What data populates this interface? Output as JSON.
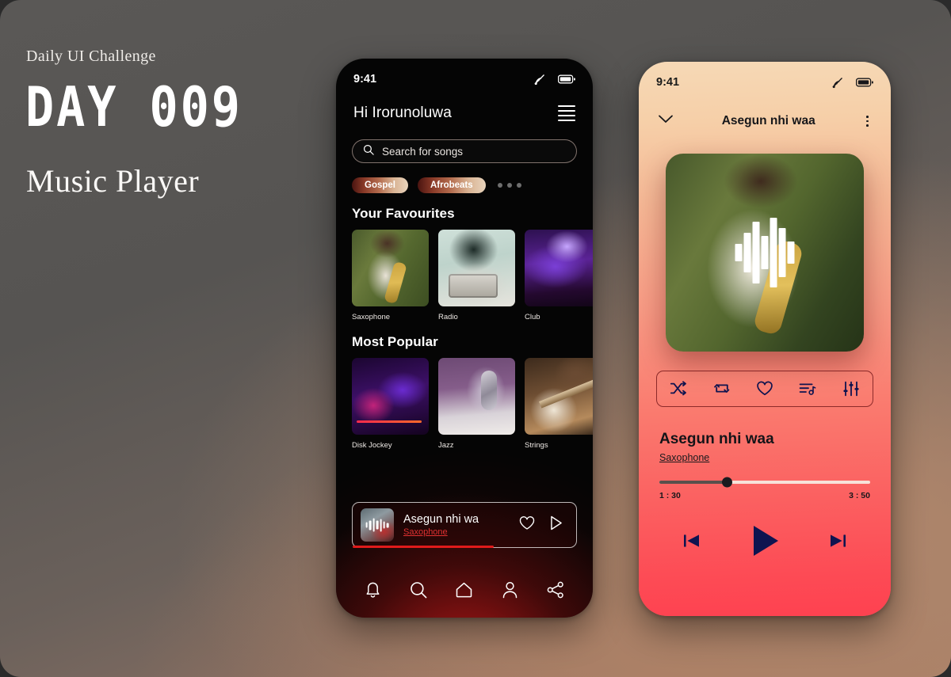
{
  "poster": {
    "challenge_label": "Daily UI Challenge",
    "day_number": "DAY 009",
    "project_title": "Music Player"
  },
  "colors": {
    "accent_red": "#e01b1b",
    "player_gradient_top": "#f6d9b6",
    "player_gradient_bottom": "#fe4150",
    "control_navy": "#0f1450",
    "chip_gradient_start": "#4a1410",
    "chip_gradient_end": "#e8d4bd"
  },
  "home_screen": {
    "status_bar": {
      "time": "9:41",
      "signal_icon": "wifi-signal-icon",
      "battery_icon": "battery-icon"
    },
    "greeting": "Hi Irorunoluwa",
    "menu_icon": "hamburger-menu-icon",
    "search": {
      "placeholder": "Search for songs",
      "icon": "search-icon"
    },
    "chips": [
      {
        "label": "Gospel"
      },
      {
        "label": "Afrobeats"
      }
    ],
    "chip_overflow_icon": "more-dots-icon",
    "sections": [
      {
        "title": "Your Favourites",
        "cards": [
          {
            "label": "Saxophone",
            "art": "art-sax"
          },
          {
            "label": "Radio",
            "art": "art-radio"
          },
          {
            "label": "Club",
            "art": "art-club"
          }
        ]
      },
      {
        "title": "Most Popular",
        "cards": [
          {
            "label": "Disk Jockey",
            "art": "art-dj"
          },
          {
            "label": "Jazz",
            "art": "art-jazz"
          },
          {
            "label": "Strings",
            "art": "art-strings"
          }
        ]
      }
    ],
    "mini_player": {
      "title": "Asegun nhi wa",
      "artist": "Saxophone",
      "like_icon": "heart-icon",
      "play_icon": "play-icon",
      "progress_percent": 63
    },
    "bottom_nav": [
      {
        "name": "notifications",
        "icon": "bell-icon"
      },
      {
        "name": "search",
        "icon": "search-icon"
      },
      {
        "name": "home",
        "icon": "home-icon"
      },
      {
        "name": "profile",
        "icon": "person-icon"
      },
      {
        "name": "share",
        "icon": "share-icon"
      }
    ]
  },
  "player_screen": {
    "status_bar": {
      "time": "9:41",
      "signal_icon": "wifi-signal-icon",
      "battery_icon": "battery-icon"
    },
    "topbar": {
      "collapse_icon": "chevron-down-icon",
      "title": "Asegun nhi waa",
      "overflow_icon": "kebab-menu-icon"
    },
    "album_art_overlay_icon": "waveform-icon",
    "controls": [
      {
        "name": "shuffle",
        "icon": "shuffle-icon"
      },
      {
        "name": "repeat",
        "icon": "repeat-icon"
      },
      {
        "name": "like",
        "icon": "heart-icon"
      },
      {
        "name": "queue",
        "icon": "playlist-icon"
      },
      {
        "name": "equalizer",
        "icon": "equalizer-icon"
      }
    ],
    "track": {
      "title": "Asegun nhi waa",
      "artist": "Saxophone"
    },
    "progress": {
      "current_time": "1 : 30",
      "total_time": "3 : 50",
      "percent": 32
    },
    "playback": [
      {
        "name": "previous",
        "icon": "skip-previous-icon"
      },
      {
        "name": "play",
        "icon": "play-icon"
      },
      {
        "name": "next",
        "icon": "skip-next-icon"
      }
    ]
  }
}
